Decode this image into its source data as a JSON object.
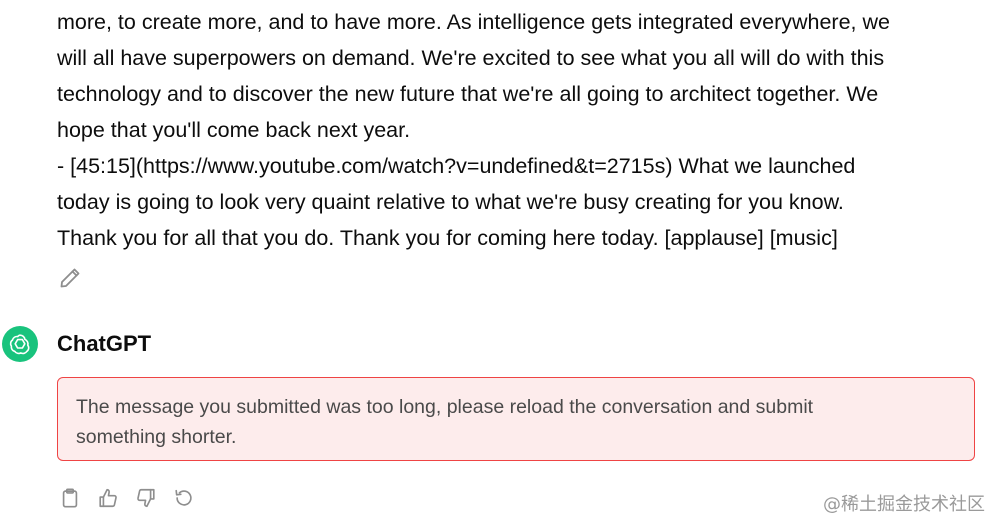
{
  "user_message": {
    "lines": [
      "more, to create more, and to have more. As intelligence gets integrated everywhere, we",
      "will all have superpowers on demand. We're excited to see what you all will do with this",
      "technology and to discover the new future that we're all going to architect together. We",
      "hope that you'll come back next year.",
      "- [45:15](https://www.youtube.com/watch?v=undefined&t=2715s) What we launched",
      "today is going to look very quaint relative to what we're busy creating for you know.",
      "Thank you for all that you do. Thank you for coming here today. [applause] [music]"
    ],
    "edit_icon": "pencil-icon"
  },
  "assistant": {
    "name": "ChatGPT",
    "avatar_icon": "openai-logo-icon",
    "avatar_color": "#19c37d"
  },
  "error": {
    "line1": "The message you submitted was too long, please reload the conversation and submit",
    "line2": "something shorter.",
    "border_color": "#ef4444",
    "background_color": "#fdecec"
  },
  "actions": [
    {
      "icon": "clipboard-icon"
    },
    {
      "icon": "thumbs-up-icon"
    },
    {
      "icon": "thumbs-down-icon"
    },
    {
      "icon": "regenerate-icon"
    }
  ],
  "watermark": "@稀土掘金技术社区"
}
